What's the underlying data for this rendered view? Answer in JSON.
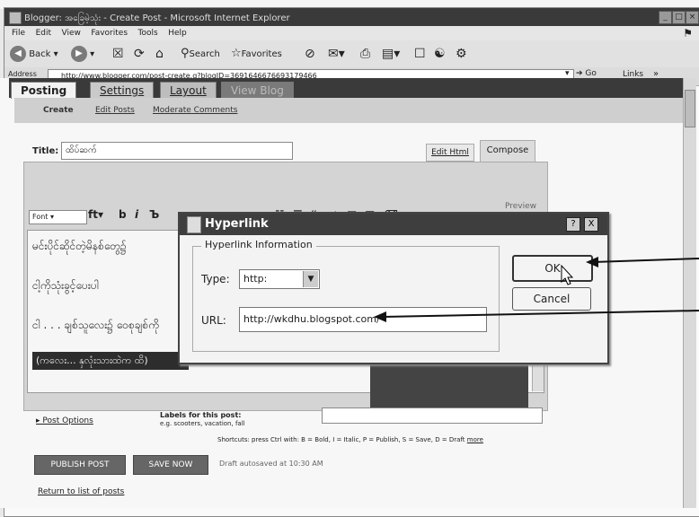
{
  "browser": {
    "title": "Blogger: အခြေမဲ့သုံး - Create Post - Microsoft Internet Explorer",
    "menus": [
      "File",
      "Edit",
      "View",
      "Favorites",
      "Tools",
      "Help"
    ],
    "toolbar": {
      "back": "Back",
      "search": "Search",
      "favorites": "Favorites"
    },
    "address_label": "Address",
    "address": "http://www.blogger.com/post-create.g?blogID=3691646676693179466",
    "go_label": "Go",
    "links_label": "Links"
  },
  "blogger": {
    "tabs": [
      "Posting",
      "Settings",
      "Layout",
      "View Blog"
    ],
    "subtabs": [
      "Create",
      "Edit Posts",
      "Moderate Comments"
    ],
    "title_label": "Title:",
    "title_value": "ထိပ်ဆက်",
    "edit_html": "Edit Html",
    "compose": "Compose",
    "preview": "Preview",
    "font_select": "Font",
    "editor_lines": [
      "မင်းပိုင်ဆိုင်တဲ့မိနစ်တွေ၌",
      "ငါ့ကိုသုံးခွင့်ပေးပါ",
      "ငါ . . . ချစ်သူလေး၌ ဝေစုချစ်ကို",
      "(ကလေး... နှလုံးသားထဲက ထိ)"
    ],
    "post_options": "Post Options",
    "labels_title": "Labels for this post:",
    "labels_example": "e.g. scooters, vacation, fall",
    "shortcuts": "Shortcuts: press Ctrl with: B = Bold, I = Italic, P = Publish, S = Save, D = Draft",
    "shortcuts_more": "more",
    "publish": "PUBLISH POST",
    "save": "SAVE NOW",
    "draft_note": "Draft autosaved at 10:30 AM",
    "return_link": "Return to list of posts"
  },
  "dialog": {
    "title": "Hyperlink",
    "group_label": "Hyperlink Information",
    "type_label": "Type:",
    "type_value": "http:",
    "url_label": "URL:",
    "url_value": "http://wkdhu.blogspot.com/",
    "ok": "OK",
    "cancel": "Cancel",
    "help": "?",
    "close": "X"
  }
}
